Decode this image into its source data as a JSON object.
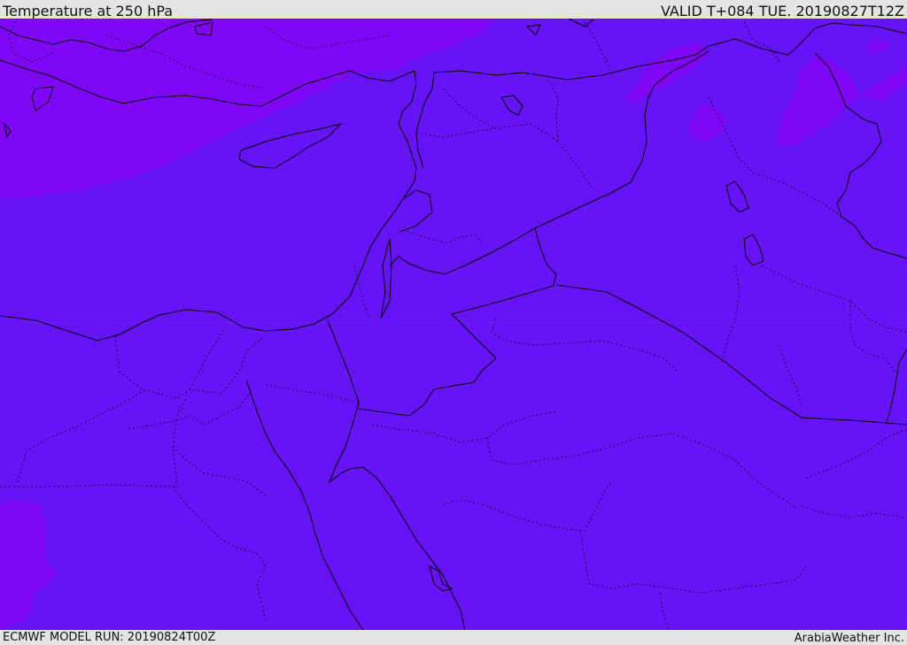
{
  "header": {
    "title": "Temperature at 250 hPa",
    "valid_time": "VALID T+084 TUE. 20190827T12Z"
  },
  "footer": {
    "model_run": "ECMWF MODEL RUN: 20190824T00Z",
    "credit": "ArabiaWeather Inc."
  },
  "map": {
    "variable": "Temperature",
    "level": "250 hPa",
    "colors": {
      "fill_main": "#6614f7",
      "fill_cold": "#7f06f8",
      "coastline": "#000000",
      "border": "#000000"
    }
  }
}
